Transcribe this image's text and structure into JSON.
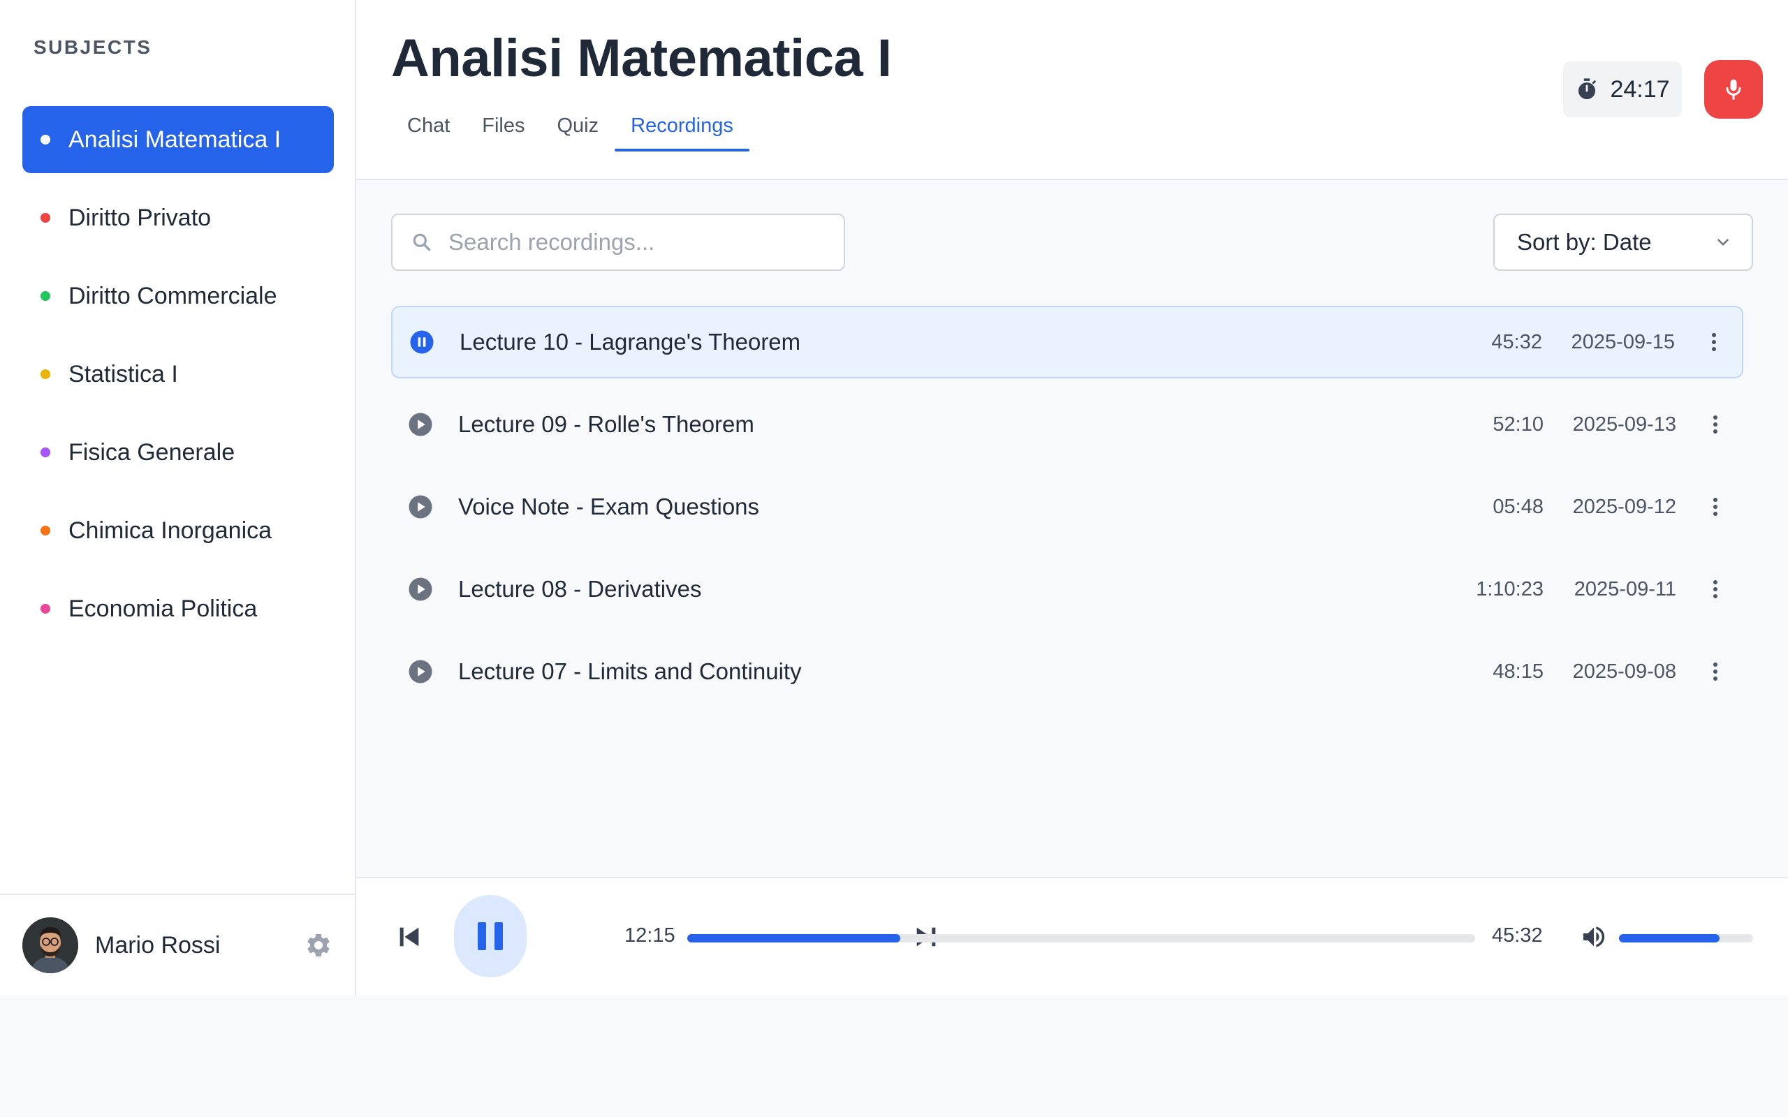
{
  "sidebar": {
    "title": "SUBJECTS",
    "subjects": [
      {
        "label": "Analisi Matematica I",
        "color": "#ffffff",
        "active": true
      },
      {
        "label": "Diritto Privato",
        "color": "#ef4444"
      },
      {
        "label": "Diritto Commerciale",
        "color": "#22c55e"
      },
      {
        "label": "Statistica I",
        "color": "#eab308"
      },
      {
        "label": "Fisica Generale",
        "color": "#a855f7"
      },
      {
        "label": "Chimica Inorganica",
        "color": "#f97316"
      },
      {
        "label": "Economia Politica",
        "color": "#ec4899"
      }
    ],
    "user": {
      "name": "Mario Rossi"
    }
  },
  "header": {
    "title": "Analisi Matematica I",
    "tabs": [
      {
        "label": "Chat"
      },
      {
        "label": "Files"
      },
      {
        "label": "Quiz"
      },
      {
        "label": "Recordings",
        "active": true
      }
    ],
    "timer": "24:17"
  },
  "toolbar": {
    "search_placeholder": "Search recordings...",
    "sort_label": "Sort by: Date"
  },
  "recordings": [
    {
      "title": "Lecture 10 - Lagrange's Theorem",
      "duration": "45:32",
      "date": "2025-09-15",
      "playing": true
    },
    {
      "title": "Lecture 09 - Rolle's Theorem",
      "duration": "52:10",
      "date": "2025-09-13"
    },
    {
      "title": "Voice Note - Exam Questions",
      "duration": "05:48",
      "date": "2025-09-12"
    },
    {
      "title": "Lecture 08 - Derivatives",
      "duration": "1:10:23",
      "date": "2025-09-11"
    },
    {
      "title": "Lecture 07 - Limits and Continuity",
      "duration": "48:15",
      "date": "2025-09-08"
    }
  ],
  "player": {
    "current_time": "12:15",
    "total_time": "45:32",
    "progress_fraction": 0.27,
    "volume_fraction": 0.75
  },
  "colors": {
    "accent": "#2563eb",
    "record": "#ef4444"
  }
}
